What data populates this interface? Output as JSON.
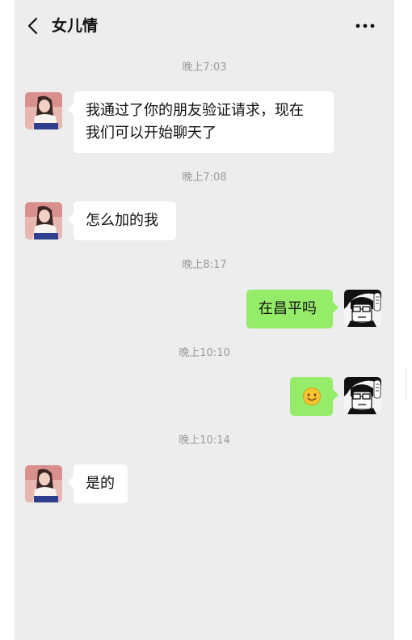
{
  "header": {
    "title": "女儿情"
  },
  "messages": [
    {
      "type": "time",
      "text": "晚上7:03"
    },
    {
      "type": "in",
      "lines": [
        "我通过了你的朋友验证请求，现在",
        "我们可以开始聊天了"
      ]
    },
    {
      "type": "time",
      "text": "晚上7:08"
    },
    {
      "type": "in",
      "text": "怎么加的我"
    },
    {
      "type": "time",
      "text": "晚上8:17"
    },
    {
      "type": "out",
      "text": "在昌平吗"
    },
    {
      "type": "time",
      "text": "晚上10:10"
    },
    {
      "type": "out",
      "emoji": "smile-emoji"
    },
    {
      "type": "time",
      "text": "晚上10:14"
    },
    {
      "type": "in",
      "text": "是的"
    }
  ],
  "colors": {
    "background": "#ededed",
    "outgoing_bubble": "#95ec69",
    "incoming_bubble": "#ffffff",
    "timestamp": "#9a9a9a"
  }
}
